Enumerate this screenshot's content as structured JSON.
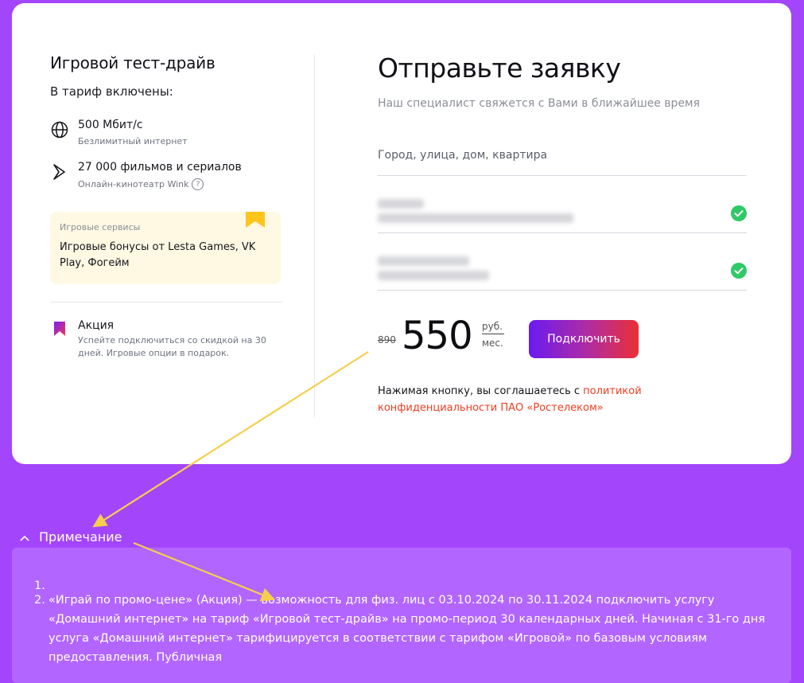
{
  "tariff": {
    "title": "Игровой тест-драйв",
    "included_label": "В тариф включены:",
    "features": [
      {
        "icon": "globe-icon",
        "title": "500 Мбит/с",
        "subtitle": "Безлимитный интернет"
      },
      {
        "icon": "wink-icon",
        "title": "27 000 фильмов и сериалов",
        "subtitle": "Онлайн-кинотеатр Wink",
        "help": "?"
      }
    ],
    "game_services": {
      "caption": "Игровые сервисы",
      "text": "Игровые бонусы от Lesta Games, VK Play, Фогейм"
    },
    "promo": {
      "title": "Акция",
      "text": "Успейте подключиться со скидкой на 30 дней. Игровые опции в подарок."
    }
  },
  "form": {
    "title": "Отправьте заявку",
    "subtitle": "Наш специалист свяжется с Вами в ближайшее время",
    "address_placeholder": "Город, улица, дом, квартира",
    "old_price": "890",
    "price": "550",
    "unit_top": "руб.",
    "unit_bottom": "мес.",
    "submit_label": "Подключить",
    "consent_prefix": "Нажимая кнопку, вы соглашаетесь с ",
    "consent_link": "политикой конфиденциальности ПАО «Ростелеком»"
  },
  "note": {
    "toggle_label": "Примечание",
    "items": [
      {
        "num": "1.",
        "text": ""
      },
      {
        "num": "2.",
        "text": "«Играй по промо-цене» (Акция) — возможность для физ. лиц с 03.10.2024 по 30.11.2024 подключить услугу «Домашний интернет» на тариф «Игровой тест-драйв» на промо-период 30 календарных дней. Начиная с 31-го дня услуга «Домашний интернет» тарифицируется в соответствии с тарифом «Игровой» по базовым условиям предоставления. Публичная"
      }
    ]
  },
  "colors": {
    "background": "#a346fb",
    "accent_link": "#ee3f21",
    "check": "#2fc968",
    "bookmark": "#ffc51a"
  }
}
